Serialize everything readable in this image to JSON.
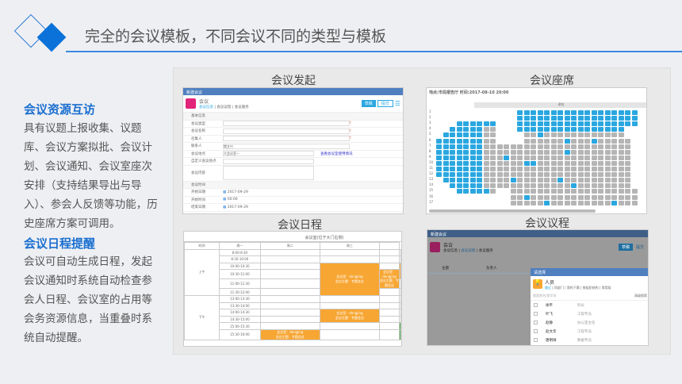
{
  "header": {
    "title": "完全的会议模板，不同会议不同的类型与模板",
    "accent": "#0a72d8"
  },
  "sections": [
    {
      "heading": "会议资源互访",
      "body": "具有议题上报收集、议题库、会议方案拟批、会议计划、会议通知、会议室座次安排（支持结果导出与导入）、参会人反馈等功能，历史座席方案可调用。"
    },
    {
      "heading": "会议日程提醒",
      "body": "会议可自动生成日程，发起会议通知时系统自动检查参会人日程、会议室的占用等会务资源信息，当重叠时系统自动提醒。"
    }
  ],
  "screens": {
    "launch": {
      "label": "会议发起",
      "window_title": "新建会议",
      "app": "会议",
      "tabs": [
        "会议信息",
        "会议议程",
        "会议服务"
      ],
      "buttons": [
        "草稿",
        "提交"
      ],
      "section1": "基本信息",
      "fields": [
        {
          "label": "会议类型",
          "value": ""
        },
        {
          "label": "会议名称",
          "value": ""
        },
        {
          "label": "召集人",
          "value": ""
        },
        {
          "label": "联系人",
          "value": "樊文兴"
        },
        {
          "label": "会议地点",
          "value": "大会议室一"
        },
        {
          "label": "自定义会议地点",
          "value": ""
        },
        {
          "label": "会议内容",
          "value": ""
        }
      ],
      "link": "查看会议室使用情况",
      "section2": "会议时间",
      "time_fields": [
        {
          "label": "开始日期",
          "value": "2017-09-29"
        },
        {
          "label": "开始时间",
          "value": "00:00"
        },
        {
          "label": "结束日期",
          "value": "2017-09-29"
        }
      ]
    },
    "seating": {
      "label": "会议座席",
      "info": "地点:市局报告厅    时间:2017-08-10 20:00",
      "stage": "讲台",
      "rows": [
        "1",
        "2",
        "3",
        "4",
        "5",
        "6",
        "7",
        "8",
        "9",
        "10",
        "11",
        "12",
        "13",
        "14",
        "15",
        "16",
        "17"
      ],
      "colors": {
        "taken": "#2aa7e0",
        "free": "#b5b5b5"
      }
    },
    "schedule": {
      "label": "会议日程",
      "room": "会议室(位于大门右侧)",
      "cols": [
        "时间",
        "周一",
        "周二",
        "周三"
      ],
      "am": "上午",
      "pm": "下午",
      "times": [
        "8:00-8:30",
        "8:30-10:00",
        "10:00-10:30",
        "10:30-11:00",
        "11:00-11:30",
        "11:30-12:00",
        "13:00-13:30",
        "13:30-14:00",
        "14:00-14:30",
        "14:30-15:00",
        "15:00-15:30",
        "15:30-16:00"
      ],
      "event_text": "会议室：dongjing",
      "event_sub": "会议主题：专题会议"
    },
    "agenda": {
      "label": "会议议程",
      "window_title": "新建会议",
      "app": "会议",
      "tabs": [
        "会议信息",
        "会议议程",
        "会议服务"
      ],
      "buttons": [
        "草稿",
        "提交"
      ],
      "cols": [
        "主题",
        "负责人"
      ],
      "picker": {
        "title": "请选择",
        "name": "人员",
        "tabs": [
          "最近",
          "同部门",
          "我的下属",
          "按组织结构",
          "常用组"
        ],
        "search_placeholder": "搜索姓名/首字母",
        "search_btn": "高级搜索",
        "people": [
          {
            "name": "徐平",
            "role": "科长"
          },
          {
            "name": "叶飞",
            "role": "工程专员"
          },
          {
            "name": "赵静",
            "role": "办公室主任"
          },
          {
            "name": "赵文华",
            "role": "工程专员"
          },
          {
            "name": "唐明祥",
            "role": "数据专员"
          }
        ]
      }
    }
  }
}
